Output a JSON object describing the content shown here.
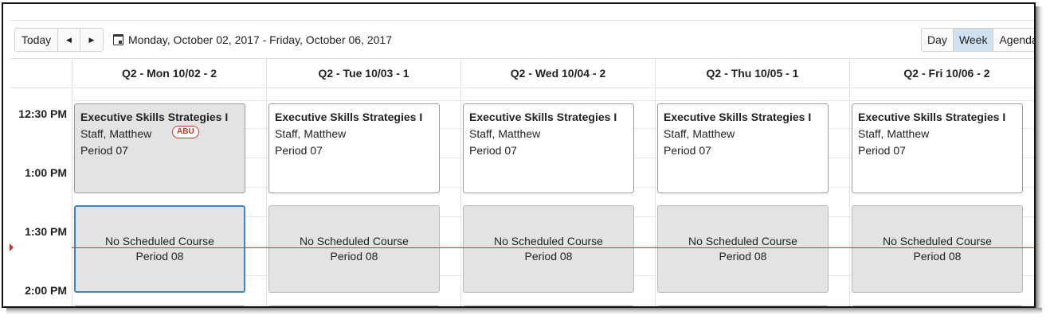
{
  "toolbar": {
    "today_label": "Today",
    "prev_icon": "◀",
    "next_icon": "▶",
    "date_range": "Monday, October 02, 2017 - Friday, October 06, 2017",
    "views": [
      "Day",
      "Week",
      "Agenda"
    ],
    "active_view": "Week"
  },
  "days": [
    {
      "header": "Q2 - Mon 10/02 - 2"
    },
    {
      "header": "Q2 - Tue 10/03 - 1"
    },
    {
      "header": "Q2 - Wed 10/04 - 2"
    },
    {
      "header": "Q2 - Thu 10/05 - 1"
    },
    {
      "header": "Q2 - Fri 10/06 - 2"
    }
  ],
  "times": [
    "12:30 PM",
    "1:00 PM",
    "1:30 PM",
    "2:00 PM"
  ],
  "events": [
    {
      "title": "Executive Skills Strategies I",
      "teacher": "Staff, Matthew",
      "period": "Period 07",
      "badge": "ABU"
    },
    {
      "title": "Executive Skills Strategies I",
      "teacher": "Staff, Matthew",
      "period": "Period 07"
    },
    {
      "title": "Executive Skills Strategies I",
      "teacher": "Staff, Matthew",
      "period": "Period 07"
    },
    {
      "title": "Executive Skills Strategies I",
      "teacher": "Staff, Matthew",
      "period": "Period 07"
    },
    {
      "title": "Executive Skills Strategies I",
      "teacher": "Staff, Matthew",
      "period": "Period 07"
    }
  ],
  "no_schedule": [
    {
      "label": "No Scheduled Course",
      "period": "Period 08"
    },
    {
      "label": "No Scheduled Course",
      "period": "Period 08"
    },
    {
      "label": "No Scheduled Course",
      "period": "Period 08"
    },
    {
      "label": "No Scheduled Course",
      "period": "Period 08"
    },
    {
      "label": "No Scheduled Course",
      "period": "Period 08"
    }
  ],
  "colors": {
    "accent": "#3a86c8",
    "current_time": "#c0392b",
    "active_view_bg": "#cfe0f0",
    "event_today_bg": "#e3e3e3"
  }
}
